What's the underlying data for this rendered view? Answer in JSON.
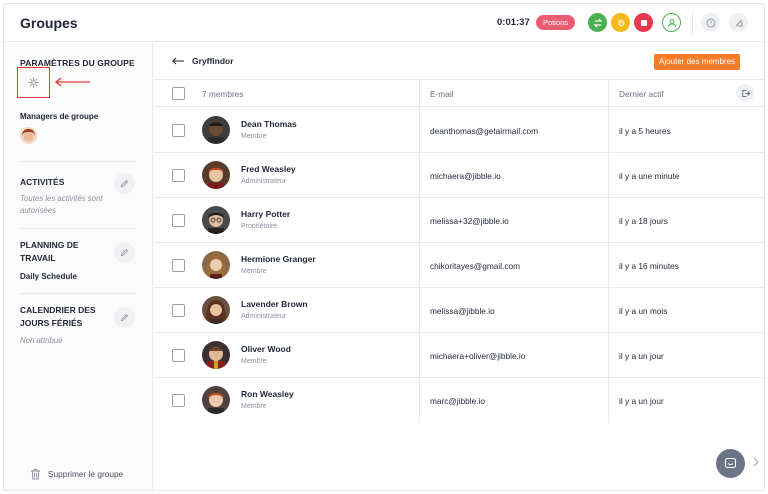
{
  "header": {
    "title": "Groupes",
    "timer": "0:01:37",
    "activity": "Potions"
  },
  "sidebar": {
    "settings_heading": "PARAMÈTRES DU GROUPE",
    "managers_label": "Managers de groupe",
    "activities": {
      "title": "ACTIVITÉS",
      "subtitle": "Toutes les activités sont autorisées"
    },
    "schedule": {
      "title": "PLANNING DE TRAVAIL",
      "value": "Daily Schedule"
    },
    "holidays": {
      "title": "CALENDRIER DES JOURS FÉRIÉS",
      "subtitle": "Non attribué"
    },
    "delete_label": "Supprimer le groupe"
  },
  "main": {
    "group_name": "Gryffindor",
    "add_members_label": "Ajouter des membres",
    "columns": {
      "members": "7 membres",
      "email": "E-mail",
      "last_active": "Dernier actif"
    },
    "rows": [
      {
        "name": "Dean Thomas",
        "role": "Membre",
        "email": "deanthomas@getairmail.com",
        "last": "il y a 5 heures"
      },
      {
        "name": "Fred Weasley",
        "role": "Administrateur",
        "email": "michaera@jibble.io",
        "last": "il y a une minute"
      },
      {
        "name": "Harry Potter",
        "role": "Propriétaire",
        "email": "melissa+32@jibble.io",
        "last": "il y a 18 jours"
      },
      {
        "name": "Hermione Granger",
        "role": "Membre",
        "email": "chikoritayes@gmail.com",
        "last": "il y a 16 minutes"
      },
      {
        "name": "Lavender Brown",
        "role": "Administrateur",
        "email": "melissa@jibble.io",
        "last": "il y a un mois"
      },
      {
        "name": "Oliver Wood",
        "role": "Membre",
        "email": "michaera+oliver@jibble.io",
        "last": "il y a un jour"
      },
      {
        "name": "Ron Weasley",
        "role": "Membre",
        "email": "marc@jibble.io",
        "last": "il y a un jour"
      }
    ]
  },
  "colors": {
    "accent_orange": "#f57c2b",
    "activity_pink": "#e85d6f",
    "clock_green": "#4caf50",
    "break_yellow": "#f6b91a",
    "stop_red": "#e53950",
    "annotation_red": "#e53935"
  }
}
